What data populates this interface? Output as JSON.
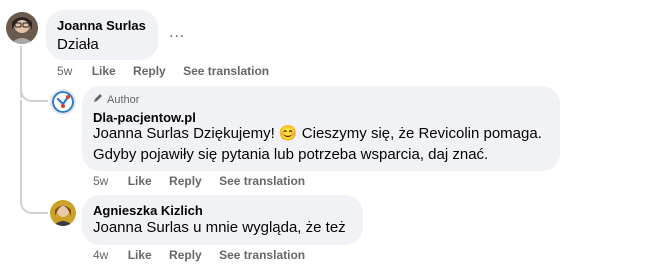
{
  "comments": [
    {
      "author": "Joanna Surlas",
      "text": "Działa",
      "more_label": "...",
      "actions": {
        "time": "5w",
        "like": "Like",
        "reply": "Reply",
        "translate": "See translation"
      }
    },
    {
      "badge": "Author",
      "author": "Dla-pacjentow.pl",
      "mention": "Joanna Surlas",
      "text_line1": "Dziękujemy! 😊 Cieszymy się, że Revicolin pomaga.",
      "text_line2": "Gdyby pojawiły się pytania lub potrzeba wsparcia, daj znać.",
      "actions": {
        "time": "5w",
        "like": "Like",
        "reply": "Reply",
        "translate": "See translation"
      }
    },
    {
      "author": "Agnieszka Kizlich",
      "mention": "Joanna Surlas",
      "text": "u mnie wygląda, że też",
      "actions": {
        "time": "4w",
        "like": "Like",
        "reply": "Reply",
        "translate": "See translation"
      }
    }
  ],
  "icons": {
    "pencil": "pencil-icon",
    "emoji": "smiling-face-emoji"
  },
  "colors": {
    "bubble": "#f0f2f5",
    "meta": "#65676b",
    "thread": "#ced0d4",
    "page_logo": "#2a7bc4"
  }
}
